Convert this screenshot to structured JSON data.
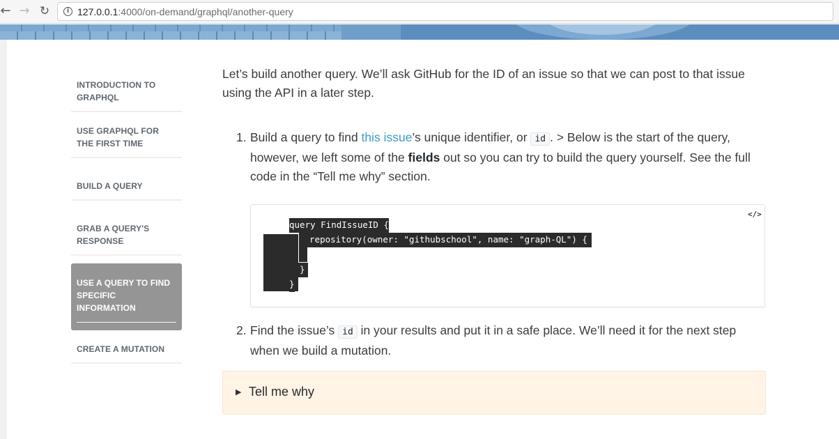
{
  "browser": {
    "url_host": "127.0.0.1",
    "url_path": ":4000/on-demand/graphql/another-query"
  },
  "sidebar": {
    "items": [
      {
        "label": "INTRODUCTION TO GRAPHQL",
        "active": false
      },
      {
        "label": "USE GRAPHQL FOR THE FIRST TIME",
        "active": false
      },
      {
        "label": "BUILD A QUERY",
        "active": false
      },
      {
        "label": "GRAB A QUERY'S RESPONSE",
        "active": false
      },
      {
        "label": "USE A QUERY TO FIND SPECIFIC INFORMATION",
        "active": true
      },
      {
        "label": "CREATE A MUTATION",
        "active": false
      }
    ]
  },
  "main": {
    "intro": "Let’s build another query. We’ll ask GitHub for the ID of an issue so that we can post to that issue using the API in a later step.",
    "step1": {
      "number": "1.",
      "text_before_link": "Build a query to find ",
      "link_text": "this issue",
      "text_after_link": "’s unique identifier, or ",
      "code": "id",
      "text_after_code": ". > Below is the start of the query, however, we left some of the ",
      "bold": "fields",
      "text_end": " out so you can try to build the query yourself. See the full code in the “Tell me why” section."
    },
    "code_block": {
      "copy_icon": "</>",
      "lines": [
        "query FindIssueID {",
        "  repository(owner: \"githubschool\", name: \"graph-QL\") {",
        "",
        "  }",
        "}"
      ]
    },
    "step2": {
      "number": "2.",
      "text_before_code": "Find the issue’s ",
      "code": "id",
      "text_after_code": " in your results and put it in a safe place. We’ll need it for the next step when we build a mutation."
    },
    "details": {
      "label": "Tell me why"
    }
  },
  "colors": {
    "link": "#3c9ec4",
    "active_sidebar": "#959595",
    "details_bg": "#fff4e6",
    "hero": "#6f9fc9"
  }
}
